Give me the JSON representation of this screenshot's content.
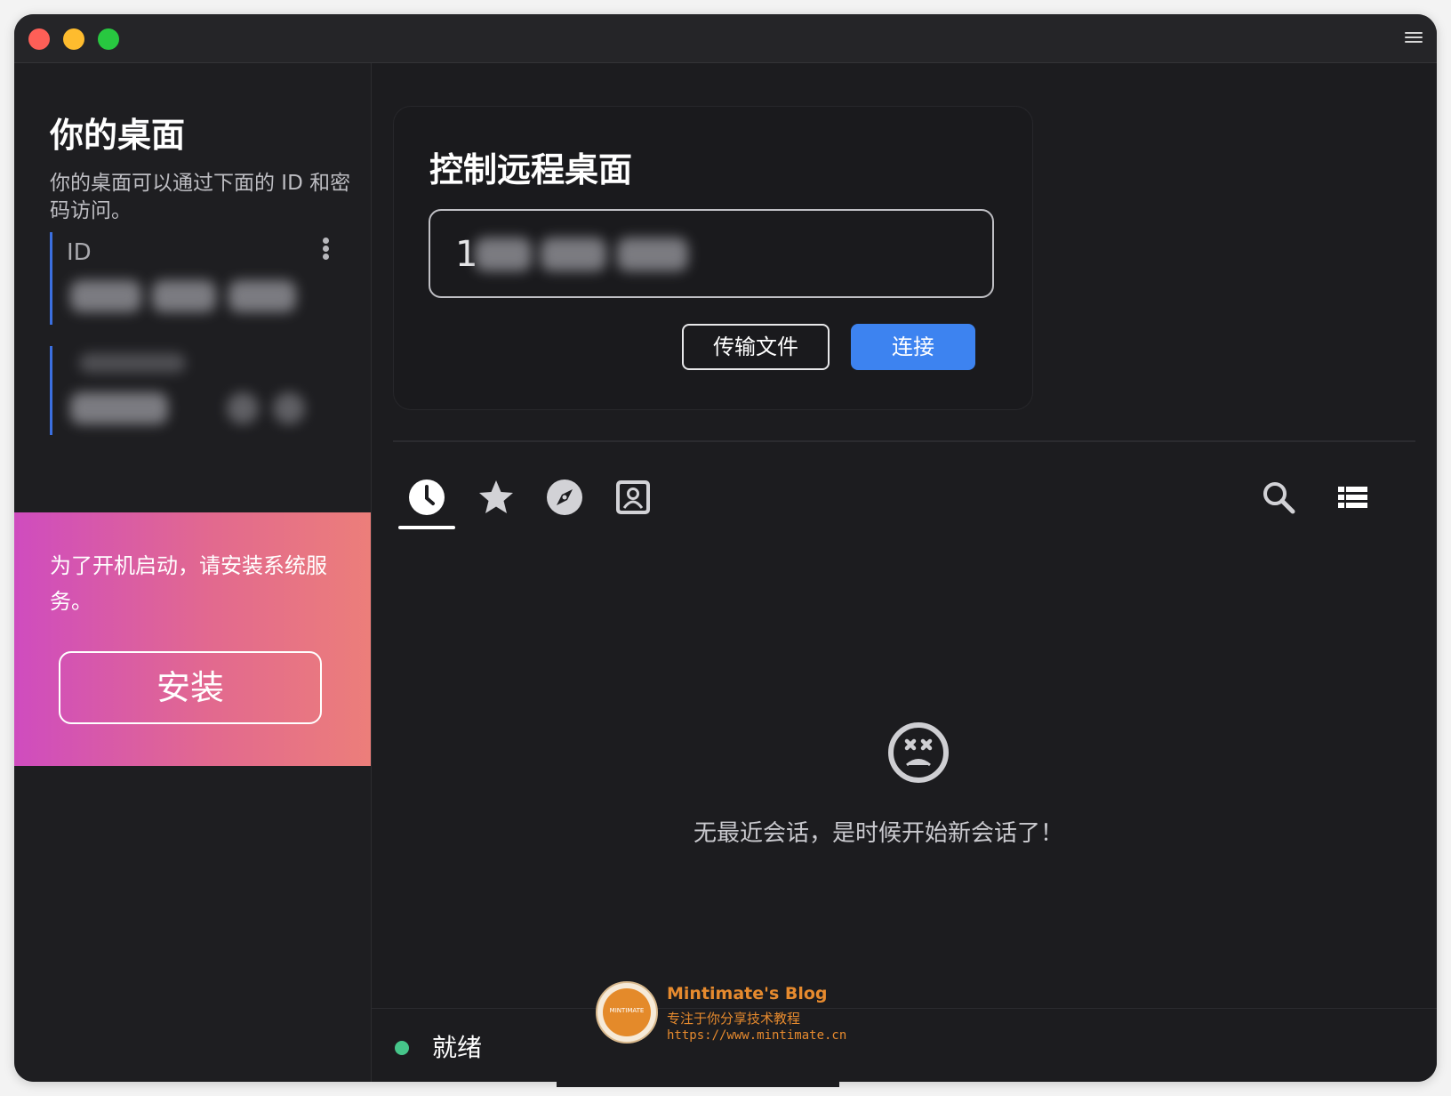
{
  "sidebar": {
    "title": "你的桌面",
    "description": "你的桌面可以通过下面的 ID 和密码访问。",
    "id_label": "ID"
  },
  "promo": {
    "text": "为了开机启动，请安装系统服务。",
    "install_label": "安装"
  },
  "remote": {
    "title": "控制远程桌面",
    "input_value": "1",
    "transfer_label": "传输文件",
    "connect_label": "连接"
  },
  "tabs": [
    {
      "icon": "clock-icon",
      "active": true
    },
    {
      "icon": "star-icon"
    },
    {
      "icon": "compass-icon"
    },
    {
      "icon": "address-book-icon"
    }
  ],
  "empty": {
    "icon": "sad-face-icon",
    "message": "无最近会话，是时候开始新会话了！"
  },
  "status": {
    "text": "就绪",
    "color": "#46c58a"
  },
  "watermark": {
    "title": "Mintimate's Blog",
    "subtitle": "专注于你分享技术教程",
    "url": "https://www.mintimate.cn",
    "logo_text": "MINTIMATE"
  },
  "colors": {
    "accent": "#3d83f0",
    "promo_start": "#cf4cbf",
    "promo_end": "#ec7e7a",
    "traffic_close": "#fe5f57",
    "traffic_min": "#febc2e",
    "traffic_max": "#28c840"
  }
}
